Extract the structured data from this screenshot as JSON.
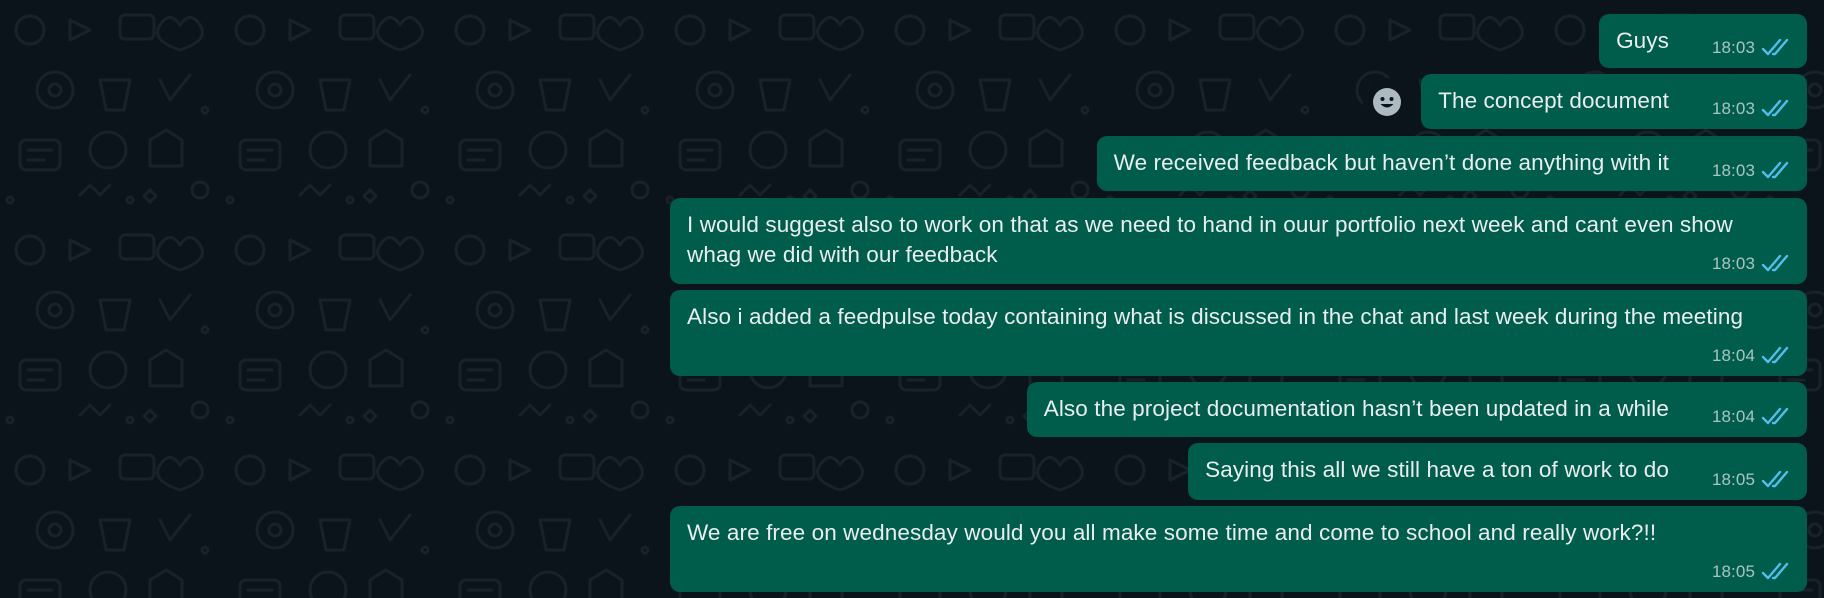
{
  "chat": {
    "messages": [
      {
        "text": "Guys",
        "time": "18:03"
      },
      {
        "text": "The concept document",
        "time": "18:03"
      },
      {
        "text": "We received feedback but haven’t done anything with it",
        "time": "18:03"
      },
      {
        "text": "I would suggest also to work on that as we need to hand in ouur portfolio next week and cant even show whag we did with our feedback",
        "time": "18:03"
      },
      {
        "text": "Also i added a feedpulse today containing what is discussed in the chat and last week during the meeting",
        "time": "18:04"
      },
      {
        "text": "Also the project documentation hasn’t been updated in a while",
        "time": "18:04"
      },
      {
        "text": "Saying this all we still have a ton of work to do",
        "time": "18:05"
      },
      {
        "text": "We are free on wednesday would you all make some time and come to school and really work?!!",
        "time": "18:05"
      }
    ],
    "read_status": "read",
    "react_icon": "smiley-icon",
    "tick_icon": "double-check-icon"
  },
  "colors": {
    "background": "#0b141a",
    "bubble": "#005c4b",
    "text": "#e9edef",
    "read_tick": "#53bdeb"
  }
}
